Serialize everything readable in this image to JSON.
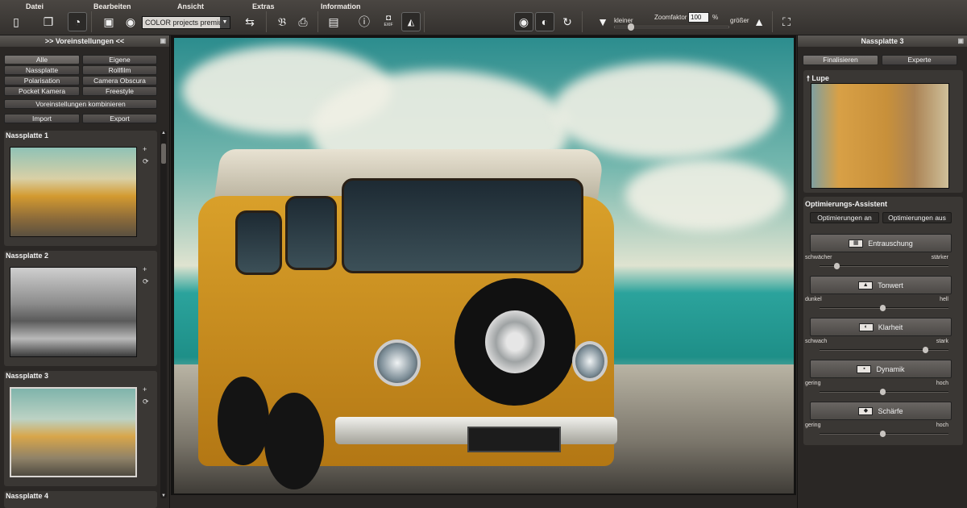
{
  "menu": {
    "items": [
      "Datei",
      "Bearbeiten",
      "Ansicht",
      "Extras",
      "Information"
    ]
  },
  "toolbar": {
    "preset_select": "COLOR projects premium",
    "exif_label": "EXIF",
    "zoom": {
      "smaller_label": "kleiner",
      "label": "Zoomfaktor",
      "value": "100",
      "percent": "%",
      "larger_label": "größer"
    }
  },
  "left_panel": {
    "header": ">> Voreinstellungen <<",
    "filter_buttons": [
      "Alle",
      "Eigene",
      "Nassplatte",
      "Rollfilm",
      "Polarisation",
      "Camera Obscura",
      "Pocket Kamera",
      "Freestyle"
    ],
    "combine_label": "Voreinstellungen kombinieren",
    "import_label": "Import",
    "export_label": "Export",
    "presets": [
      "Nassplatte 1",
      "Nassplatte 2",
      "Nassplatte 3",
      "Nassplatte 4"
    ]
  },
  "right_panel": {
    "header": "Nassplatte 3",
    "tabs": [
      "Finalisieren",
      "Experte"
    ],
    "lupe_label": "Lupe",
    "assistant_title": "Optimierungs-Assistent",
    "opt_on": "Optimierungen an",
    "opt_off": "Optimierungen aus",
    "filters": [
      {
        "label": "Entrauschung",
        "min": "schwächer",
        "max": "stärker",
        "level": 0.12
      },
      {
        "label": "Tonwert",
        "min": "dunkel",
        "max": "hell",
        "level": 0.5
      },
      {
        "label": "Klarheit",
        "min": "schwach",
        "max": "stark",
        "level": 0.85
      },
      {
        "label": "Dynamik",
        "min": "gering",
        "max": "hoch",
        "level": 0.5
      },
      {
        "label": "Schärfe",
        "min": "gering",
        "max": "hoch",
        "level": 0.5
      }
    ]
  },
  "colors": {
    "accent": "#d9a02a",
    "panel": "#2a2725",
    "button": "#4a4644"
  },
  "zoom_slider_level": 0.12
}
